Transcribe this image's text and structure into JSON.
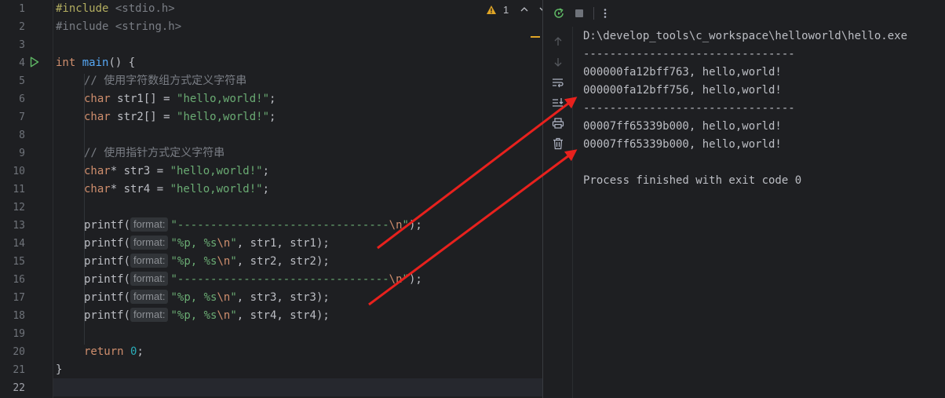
{
  "editor": {
    "line_numbers": [
      "1",
      "2",
      "3",
      "4",
      "5",
      "6",
      "7",
      "8",
      "9",
      "10",
      "11",
      "12",
      "13",
      "14",
      "15",
      "16",
      "17",
      "18",
      "19",
      "20",
      "21",
      "22"
    ],
    "include1": {
      "directive": "#include",
      "header": " <stdio.h>"
    },
    "include2": {
      "directive": "#include",
      "header": " <string.h>"
    },
    "main_kw": "int",
    "main_fn": "main",
    "main_rest": "() {",
    "comment1": "// 使用字符数组方式定义字符串",
    "str1_type": "char",
    "str1_decl": " str1[] = ",
    "str1_val": "\"hello,world!\"",
    "semi": ";",
    "str2_type": "char",
    "str2_decl": " str2[] = ",
    "str2_val": "\"hello,world!\"",
    "comment2": "// 使用指针方式定义字符串",
    "str3_type": "char",
    "str3_decl": "* str3 = ",
    "str3_val": "\"hello,world!\"",
    "str4_type": "char",
    "str4_decl": "* str4 = ",
    "str4_val": "\"hello,world!\"",
    "printf": "printf(",
    "hint": "format:",
    "sep_str": "\"--------------------------------",
    "newline_esc": "\\n",
    "sep_end": "\");",
    "fmt_a": "\"%p, %s",
    "fmt_b": "\"",
    "args12_1": ", str1, str1);",
    "args12_2": ", str2, str2);",
    "args34_3": ", str3, str3);",
    "args34_4": ", str4, str4);",
    "return_kw": "return",
    "return_val": "0",
    "close_brace": "}",
    "inspection": {
      "warning_count": "1"
    }
  },
  "console": {
    "lines": [
      "D:\\develop_tools\\c_workspace\\helloworld\\hello.exe",
      "--------------------------------",
      "000000fa12bff763, hello,world!",
      "000000fa12bff756, hello,world!",
      "--------------------------------",
      "00007ff65339b000, hello,world!",
      "00007ff65339b000, hello,world!",
      "",
      "Process finished with exit code 0"
    ]
  },
  "icons": {
    "toolbar": [
      "rerun-icon",
      "stop-icon",
      "more-icon"
    ],
    "sidebar": [
      "scroll-up-icon",
      "scroll-down-icon",
      "soft-wrap-icon",
      "scroll-to-end-icon",
      "print-icon",
      "trash-icon"
    ],
    "gutter": [
      "run-gutter-icon"
    ]
  },
  "colors": {
    "background": "#1e1f22",
    "keyword": "#cf8e6d",
    "function": "#56a8f5",
    "string": "#6aab73",
    "number": "#2aacb8",
    "comment": "#7a7e85",
    "arrow": "#e8211d",
    "warning": "#e0a526"
  }
}
